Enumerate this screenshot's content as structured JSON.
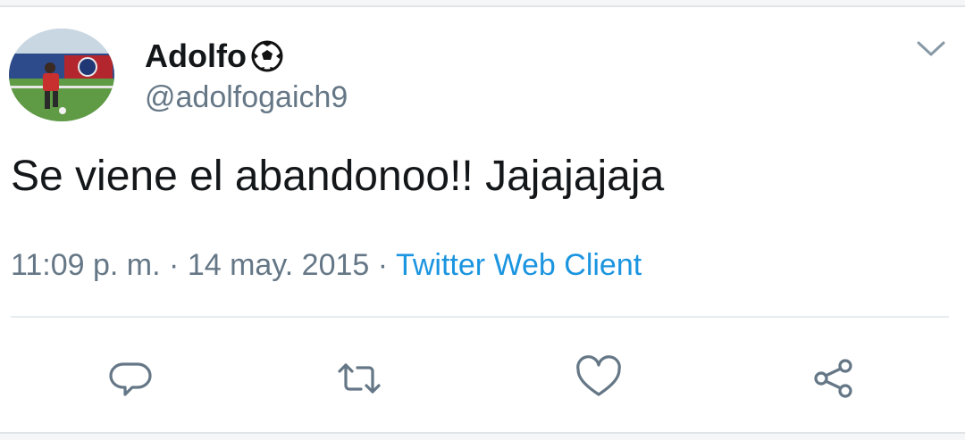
{
  "tweet": {
    "display_name": "Adolfo",
    "handle": "@adolfogaich9",
    "text": "Se viene el abandonoo!! Jajajajaja",
    "time": "11:09 p. m.",
    "date": "14 may. 2015",
    "separator": "·",
    "source": "Twitter Web Client"
  },
  "icons": {
    "name_emoji": "soccer-ball-icon",
    "menu": "chevron-down-icon",
    "actions": [
      "reply-icon",
      "retweet-icon",
      "like-icon",
      "share-icon"
    ]
  },
  "colors": {
    "text": "#14171a",
    "secondary": "#657786",
    "link": "#1b95e0",
    "divider": "#e6ecf0"
  }
}
